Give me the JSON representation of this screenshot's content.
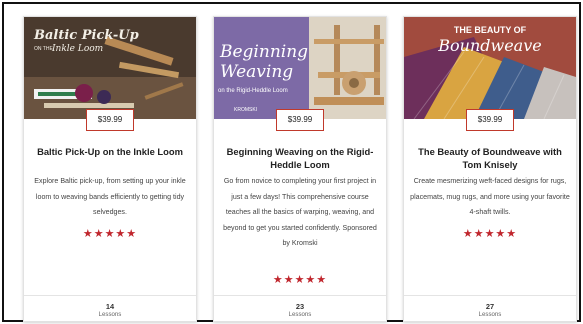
{
  "courses": [
    {
      "image_title": "Baltic Pick-Up",
      "image_subtitle_small": "ON THE",
      "image_subtitle": "Inkle Loom",
      "price": "$39.99",
      "title": "Baltic Pick-Up on the Inkle Loom",
      "description": "Explore Baltic pick-up, from setting up your inkle loom to weaving bands efficiently to getting tidy selvedges.",
      "rating": "★★★★★",
      "lessons_count": "14",
      "lessons_label": "Lessons"
    },
    {
      "image_title_line1": "Beginning",
      "image_title_line2": "Weaving",
      "image_subtitle": "on the Rigid-Heddle Loom",
      "image_brand": "KROMSKI",
      "price": "$39.99",
      "title": "Beginning Weaving on the Rigid-Heddle Loom",
      "description": "Go from novice to completing your first project in just a few days! This comprehensive course teaches all the basics of warping, weaving, and beyond to get you started confidently. Sponsored by Kromski",
      "rating": "★★★★★",
      "lessons_count": "23",
      "lessons_label": "Lessons"
    },
    {
      "image_title_line1": "THE BEAUTY OF",
      "image_title_line2": "Boundweave",
      "price": "$39.99",
      "title": "The Beauty of Boundweave with Tom Knisely",
      "description": "Create mesmerizing weft-faced designs for rugs, placemats, mug rugs, and more using your favorite 4-shaft twills.",
      "rating": "★★★★★",
      "lessons_count": "27",
      "lessons_label": "Lessons"
    }
  ],
  "colors": {
    "price_border": "#c0392b",
    "stars": "#c0262d"
  }
}
